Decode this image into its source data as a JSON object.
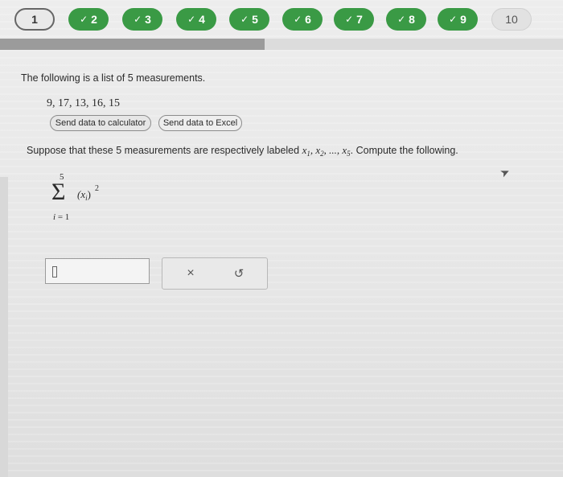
{
  "nav": {
    "steps": [
      {
        "label": "1",
        "state": "current"
      },
      {
        "label": "2",
        "state": "done"
      },
      {
        "label": "3",
        "state": "done"
      },
      {
        "label": "4",
        "state": "done"
      },
      {
        "label": "5",
        "state": "done"
      },
      {
        "label": "6",
        "state": "done"
      },
      {
        "label": "7",
        "state": "done"
      },
      {
        "label": "8",
        "state": "done"
      },
      {
        "label": "9",
        "state": "done"
      },
      {
        "label": "10",
        "state": "todo"
      }
    ],
    "check_glyph": "✓",
    "progress_fraction": 0.47
  },
  "problem": {
    "intro_text": "The following is a list of 5 measurements.",
    "measurements": "9, 17, 13, 16, 15",
    "send_calculator_label": "Send data to calculator",
    "send_excel_label": "Send data to Excel",
    "question_prefix": "Suppose that these 5 measurements are respectively labeled ",
    "question_vars": [
      "x",
      "1",
      ", x",
      "2",
      ", ..., x",
      "5"
    ],
    "question_suffix": ". Compute the following."
  },
  "expression": {
    "sigma": "Σ",
    "upper": "5",
    "lower_var": "i",
    "lower_eq": " = 1",
    "term_open": "(x",
    "term_sub": "i",
    "term_close": ")",
    "power": "2"
  },
  "answer": {
    "value": "",
    "clear_label": "×",
    "undo_label": "↺"
  },
  "colors": {
    "done": "#3a9a45",
    "progress": "#9b9b9b"
  }
}
